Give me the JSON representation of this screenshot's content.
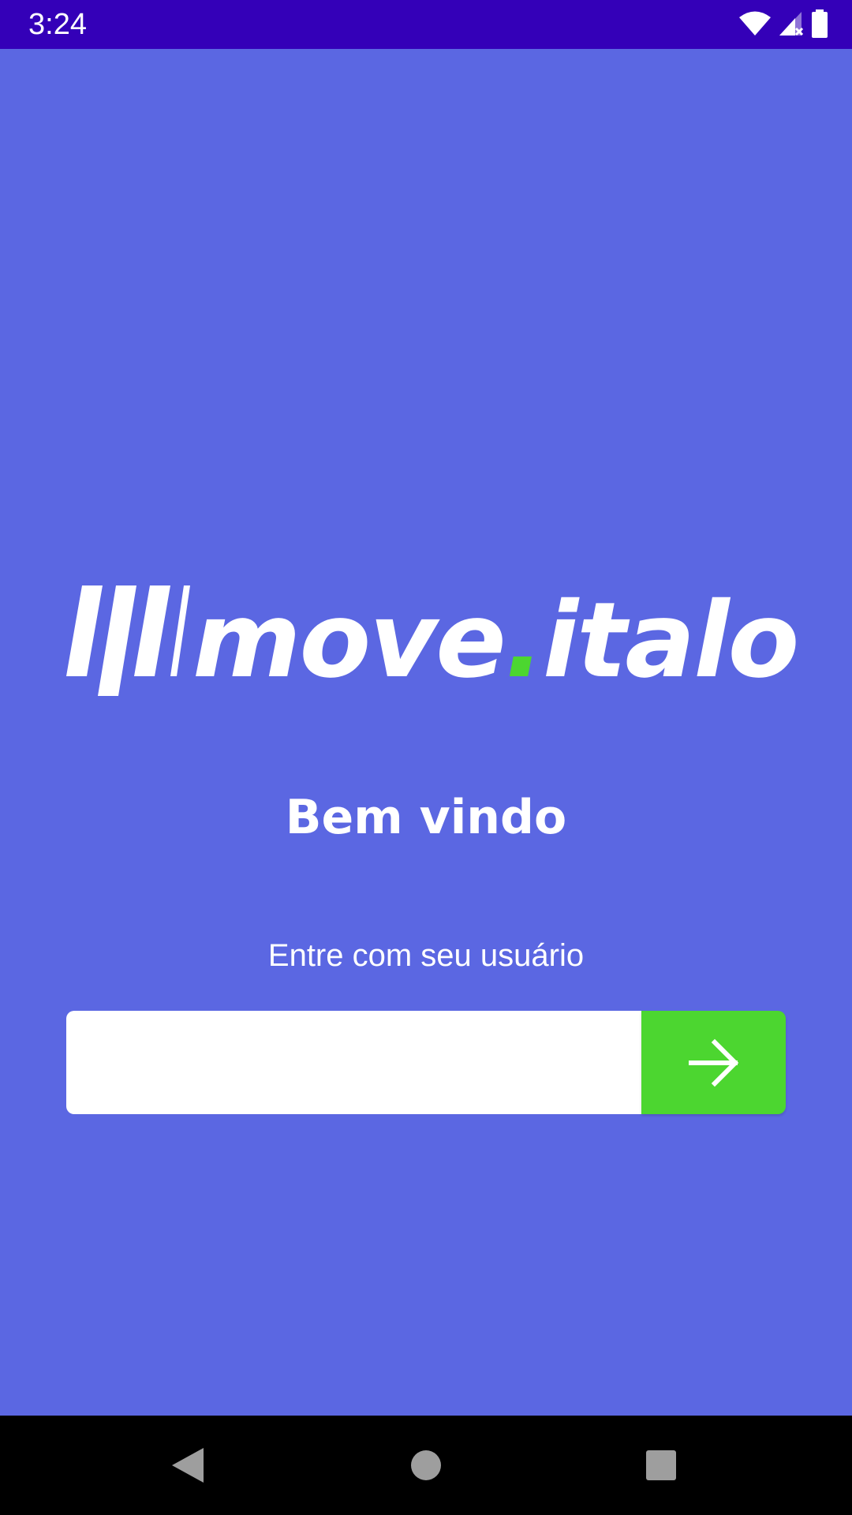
{
  "status_bar": {
    "time": "3:24",
    "icons": [
      "wifi-icon",
      "signal-icon",
      "battery-icon"
    ],
    "background": "#3400B8"
  },
  "logo": {
    "text_main": "move",
    "dot": ".",
    "text_end": "italo",
    "dot_color": "#4CD630"
  },
  "welcome": {
    "title": "Bem vindo",
    "subtitle": "Entre com seu usuário"
  },
  "login": {
    "username_value": "",
    "username_placeholder": "",
    "submit_icon": "arrow-right-icon",
    "submit_color": "#4CD630"
  },
  "nav_bar": {
    "buttons": [
      "back-icon",
      "home-icon",
      "recents-icon"
    ]
  },
  "colors": {
    "background": "#5B67E2",
    "text": "#FFFFFF"
  }
}
